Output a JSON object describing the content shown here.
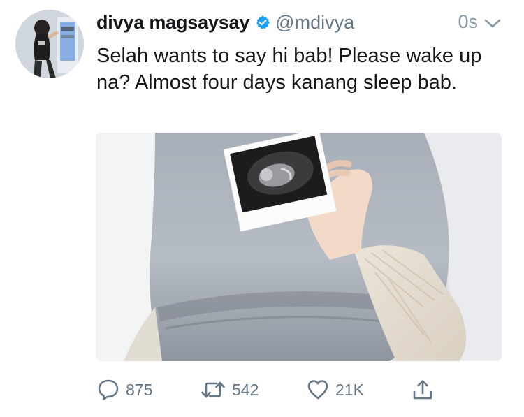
{
  "tweet": {
    "author": {
      "display_name": "divya magsaysay",
      "handle": "@mdivya",
      "verified": true
    },
    "timestamp": "0s",
    "text": "Selah wants to say hi bab! Please wake up na? Almost four days kanang sleep bab.",
    "actions": {
      "reply_count": "875",
      "retweet_count": "542",
      "like_count": "21K"
    }
  },
  "icons": {
    "verified": "verified-badge-icon",
    "menu": "chevron-down-icon",
    "reply": "speech-bubble-icon",
    "retweet": "retweet-arrows-icon",
    "like": "heart-icon",
    "share": "share-arrow-icon"
  },
  "colors": {
    "verified_blue": "#1da1f2",
    "secondary_text": "#657786",
    "icon_gray": "#657786"
  }
}
